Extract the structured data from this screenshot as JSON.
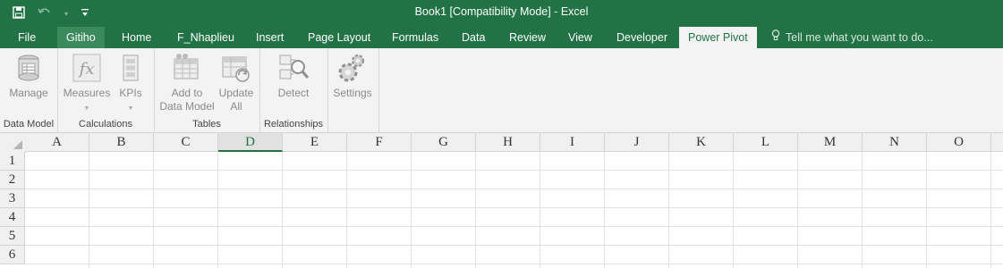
{
  "window": {
    "title": "Book1  [Compatibility Mode] - Excel"
  },
  "qat": {
    "save_icon": "save-icon",
    "redo_icon": "redo-icon",
    "customize_icon": "customize-qat-icon"
  },
  "tabs": [
    "File",
    "Gitiho",
    "Home",
    "F_Nhaplieu",
    "Insert",
    "Page Layout",
    "Formulas",
    "Data",
    "Review",
    "View",
    "Developer",
    "Power Pivot"
  ],
  "active_tab": "Power Pivot",
  "tellme": {
    "text": "Tell me what you want to do..."
  },
  "ribbon": {
    "groups": [
      {
        "label": "Data Model",
        "buttons": [
          {
            "label": "Manage",
            "icon": "manage-data-model-icon"
          }
        ]
      },
      {
        "label": "Calculations",
        "buttons": [
          {
            "label": "Measures",
            "icon": "fx-measures-icon"
          },
          {
            "label": "KPIs",
            "icon": "kpis-icon"
          }
        ]
      },
      {
        "label": "Tables",
        "buttons": [
          {
            "label": "Add to Data Model",
            "icon": "add-to-data-model-icon"
          },
          {
            "label": "Update All",
            "icon": "update-all-icon"
          }
        ]
      },
      {
        "label": "Relationships",
        "buttons": [
          {
            "label": "Detect",
            "icon": "detect-relationships-icon"
          }
        ]
      },
      {
        "label": "",
        "buttons": [
          {
            "label": "Settings",
            "icon": "settings-gears-icon"
          }
        ]
      }
    ],
    "add_line1": "Add to",
    "add_line2": "Data Model",
    "update_line1": "Update",
    "update_line2": "All"
  },
  "sheet": {
    "columns": [
      "A",
      "B",
      "C",
      "D",
      "E",
      "F",
      "G",
      "H",
      "I",
      "J",
      "K",
      "L",
      "M",
      "N",
      "O"
    ],
    "selected_column": "D",
    "rows": [
      "1",
      "2",
      "3",
      "4",
      "5",
      "6"
    ]
  },
  "colors": {
    "excel_green": "#217346",
    "ribbon_bg": "#f3f3f3"
  }
}
